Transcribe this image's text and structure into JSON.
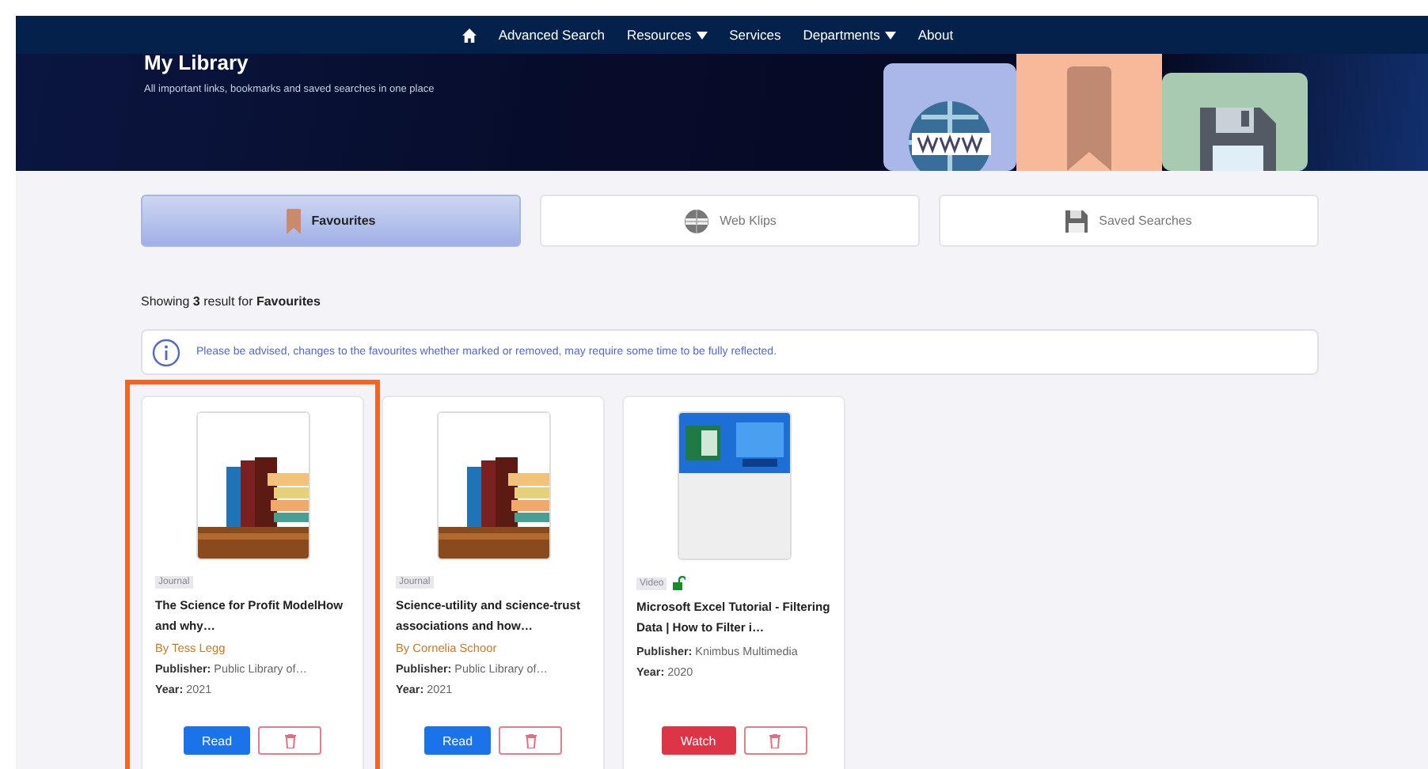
{
  "nav": {
    "items": [
      {
        "label": "Advanced Search",
        "dropdown": false
      },
      {
        "label": "Resources",
        "dropdown": true
      },
      {
        "label": "Services",
        "dropdown": false
      },
      {
        "label": "Departments",
        "dropdown": true
      },
      {
        "label": "About",
        "dropdown": false
      }
    ]
  },
  "banner": {
    "title": "My Library",
    "subtitle": "All important links, bookmarks and saved searches in one place"
  },
  "tabs": [
    {
      "label": "Favourites",
      "kind": "bookmark",
      "selected": true
    },
    {
      "label": "Web Klips",
      "kind": "globe",
      "selected": false
    },
    {
      "label": "Saved Searches",
      "kind": "floppy",
      "selected": false
    }
  ],
  "results": {
    "prefix": "Showing",
    "count": "3",
    "middle": "result for",
    "target": "Favourites"
  },
  "notice": "Please be advised, changes to the favourites whether marked or removed, may require some time to be fully reflected.",
  "cards": [
    {
      "highlighted": true,
      "type": "Journal",
      "open_access": false,
      "title": "The Science for Profit ModelHow and why…",
      "author": "By Tess Legg",
      "publisher_label": "Publisher:",
      "publisher": "Public Library of…",
      "year_label": "Year:",
      "year": "2021",
      "action": {
        "label": "Read",
        "kind": "read"
      }
    },
    {
      "highlighted": false,
      "type": "Journal",
      "open_access": false,
      "title": "Science-utility and science-trust associations and how…",
      "author": "By Cornelia Schoor",
      "publisher_label": "Publisher:",
      "publisher": "Public Library of…",
      "year_label": "Year:",
      "year": "2021",
      "action": {
        "label": "Read",
        "kind": "read"
      }
    },
    {
      "highlighted": false,
      "type": "Video",
      "open_access": true,
      "title": "Microsoft Excel Tutorial - Filtering Data | How to Filter i…",
      "publisher_label": "Publisher:",
      "publisher": "Knimbus Multimedia",
      "year_label": "Year:",
      "year": "2020",
      "action": {
        "label": "Watch",
        "kind": "watch"
      }
    }
  ]
}
